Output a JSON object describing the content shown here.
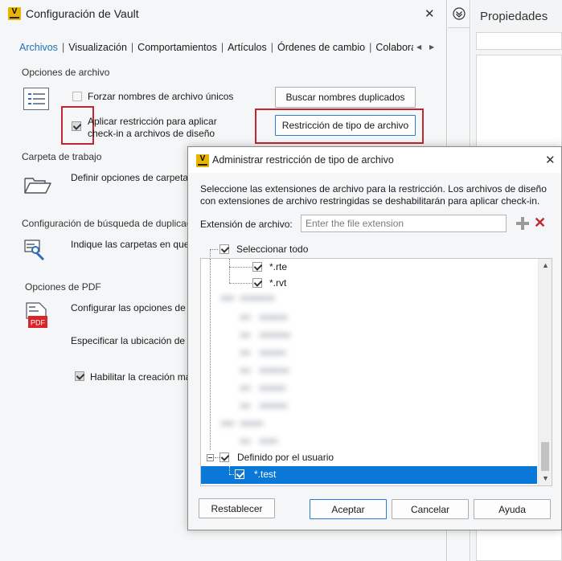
{
  "main_window": {
    "title": "Configuración de Vault",
    "logo_letter": "V",
    "tabs": [
      {
        "label": "Archivos",
        "active": true
      },
      {
        "label": "Visualización",
        "active": false
      },
      {
        "label": "Comportamientos",
        "active": false
      },
      {
        "label": "Artículos",
        "active": false
      },
      {
        "label": "Órdenes de cambio",
        "active": false
      },
      {
        "label": "Colabora",
        "active": false
      }
    ],
    "file_options": {
      "title": "Opciones de archivo",
      "force_unique_label": "Forzar nombres de archivo únicos",
      "force_unique_checked": false,
      "find_duplicates_button": "Buscar nombres duplicados",
      "apply_restriction_label_line1": "Aplicar restricción para aplicar",
      "apply_restriction_label_line2": "check-in a archivos de diseño",
      "apply_restriction_checked": true,
      "file_type_restriction_button": "Restricción de tipo de archivo"
    },
    "working_folder": {
      "title": "Carpeta de trabajo",
      "define_options_text": "Definir opciones de carpeta"
    },
    "duplicate_search": {
      "title": "Configuración de búsqueda de duplicados",
      "indicate_folders_text": "Indique las carpetas en que"
    },
    "pdf_options": {
      "title": "Opciones de PDF",
      "configure_text": "Configurar las opciones de p",
      "specify_location_text": "Especificar la ubicación de p",
      "enable_creation_label": "Habilitar la creación ma",
      "enable_creation_checked": true,
      "pdf_badge": "PDF"
    }
  },
  "properties_panel": {
    "title": "Propiedades"
  },
  "dialog": {
    "title": "Administrar restricción de tipo de archivo",
    "description": "Seleccione las extensiones de archivo para la restricción. Los archivos de diseño con extensiones de archivo restringidas se deshabilitarán para aplicar check-in.",
    "extension_label": "Extensión de archivo:",
    "extension_placeholder": "Enter the file extension",
    "extension_value": "",
    "select_all_label": "Seleccionar todo",
    "select_all_checked": true,
    "tree_items": [
      {
        "label": "*.rte",
        "checked": true
      },
      {
        "label": "*.rvt",
        "checked": true
      }
    ],
    "user_defined_label": "Definido por el usuario",
    "user_defined_checked": true,
    "user_defined_items": [
      {
        "label": "*.test",
        "checked": true,
        "selected": true
      }
    ],
    "buttons": {
      "reset": "Restablecer",
      "accept": "Aceptar",
      "cancel": "Cancelar",
      "help": "Ayuda"
    }
  },
  "colors": {
    "accent_blue": "#1f6fb8",
    "highlight_red": "#c0282d",
    "selection_blue": "#0a78d7",
    "logo_yellow": "#e8b400"
  }
}
